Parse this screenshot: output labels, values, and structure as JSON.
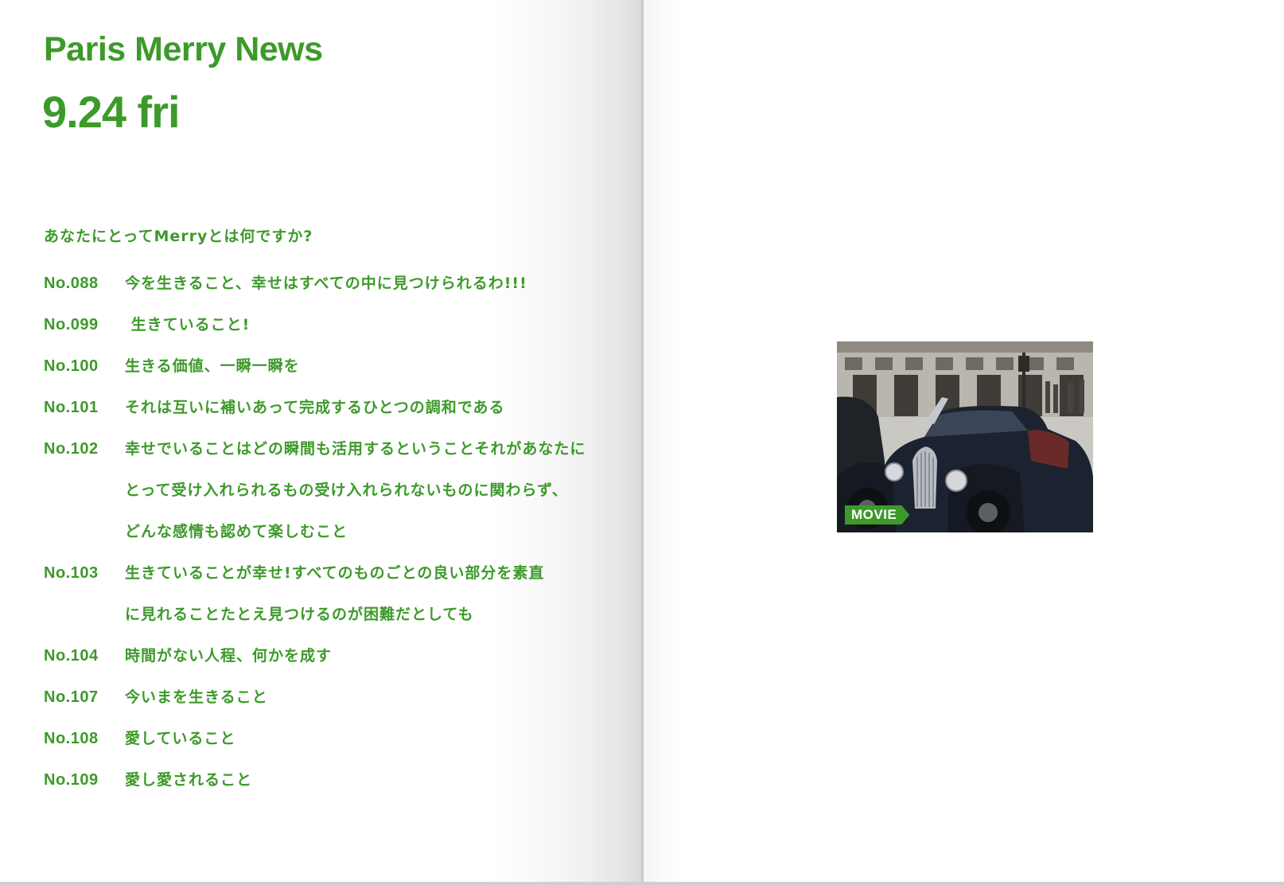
{
  "newsletter": {
    "title": "Paris Merry News",
    "date": "9.24 fri"
  },
  "question": "あなたにとってMerryとは何ですか?",
  "answers": [
    {
      "num": "No.088",
      "lines": [
        "今を生きること、幸せはすべての中に見つけられるわ!!!"
      ]
    },
    {
      "num": "No.099",
      "lines": [
        " 生きていること!"
      ]
    },
    {
      "num": "No.100",
      "lines": [
        "生きる価値、一瞬一瞬を"
      ]
    },
    {
      "num": "No.101",
      "lines": [
        "それは互いに補いあって完成するひとつの調和である"
      ]
    },
    {
      "num": "No.102",
      "lines": [
        "幸せでいることはどの瞬間も活用するということそれがあなたに",
        "とって受け入れられるもの受け入れられないものに関わらず、",
        "どんな感情も認めて楽しむこと"
      ]
    },
    {
      "num": "No.103",
      "lines": [
        "生きていることが幸せ!すべてのものごとの良い部分を素直",
        "に見れることたとえ見つけるのが困難だとしても"
      ]
    },
    {
      "num": "No.104",
      "lines": [
        "時間がない人程、何かを成す"
      ]
    },
    {
      "num": "No.107",
      "lines": [
        "今いまを生きること"
      ]
    },
    {
      "num": "No.108",
      "lines": [
        "愛していること"
      ]
    },
    {
      "num": "No.109",
      "lines": [
        "愛し愛されること"
      ]
    }
  ],
  "movie": {
    "badge_label": "MOVIE",
    "icon": "vintage-car-thumbnail"
  },
  "colors": {
    "accent_green": "#3d9a2a"
  }
}
